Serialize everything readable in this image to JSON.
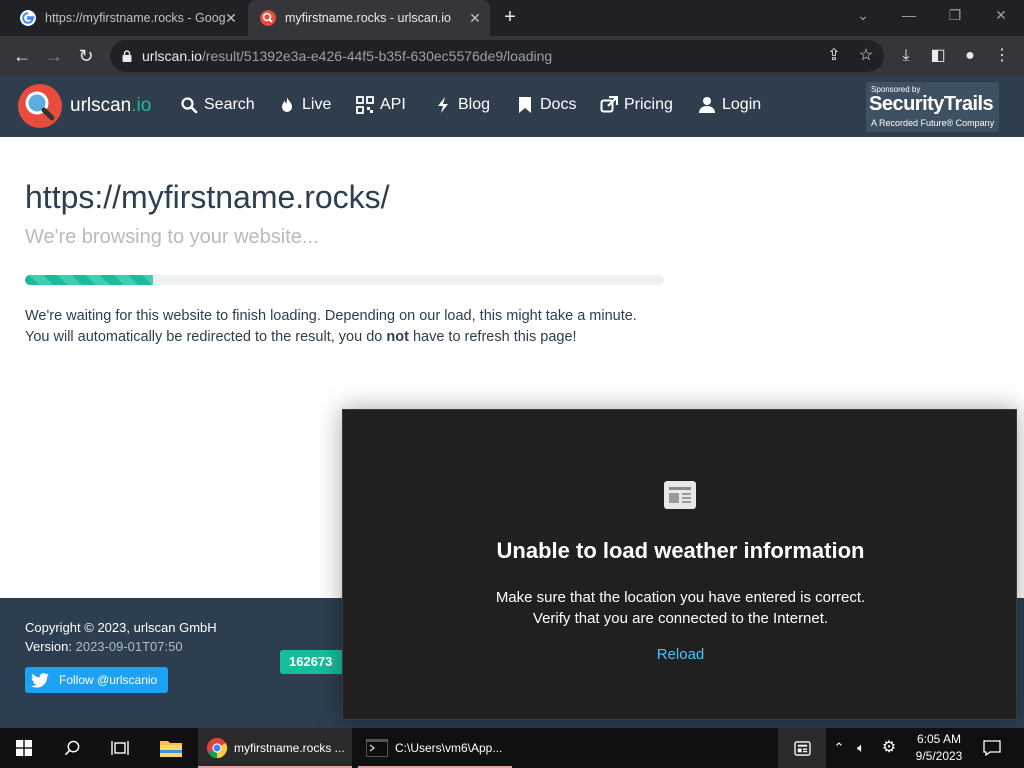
{
  "browser": {
    "tabs": [
      {
        "title": "https://myfirstname.rocks - Goog",
        "active": false,
        "favicon": "google-icon"
      },
      {
        "title": "myfirstname.rocks - urlscan.io",
        "active": true,
        "favicon": "urlscan-icon"
      }
    ],
    "address": {
      "host": "urlscan.io",
      "path": "/result/51392e3a-e426-44f5-b35f-630ec5576de9/loading"
    }
  },
  "site": {
    "logo": {
      "name": "urlscan",
      "tld": ".io"
    },
    "nav": [
      {
        "label": "Search",
        "icon": "search-icon"
      },
      {
        "label": "Live",
        "icon": "fire-icon"
      },
      {
        "label": "API",
        "icon": "qrcode-icon"
      },
      {
        "label": "Blog",
        "icon": "bolt-icon"
      },
      {
        "label": "Docs",
        "icon": "bookmark-icon"
      },
      {
        "label": "Pricing",
        "icon": "external-link-icon"
      },
      {
        "label": "Login",
        "icon": "user-icon"
      }
    ],
    "sponsor": {
      "line1": "Sponsored by",
      "line2": "SecurityTrails",
      "line3": "A Recorded Future® Company"
    }
  },
  "main": {
    "heading": "https://myfirstname.rocks/",
    "subheading": "We're browsing to your website...",
    "progress": 0.2,
    "para_line1": "We're waiting for this website to finish loading. Depending on our load, this might take a minute.",
    "para_line2_a": "You will automatically be redirected to the result, you do ",
    "para_line2_b": "not",
    "para_line2_c": " have to refresh this page!"
  },
  "footer": {
    "copyright": "Copyright © 2023, urlscan GmbH",
    "version_label": "Version:",
    "version": "2023-09-01T07:50",
    "follow": "Follow @urlscanio",
    "counter": "162673"
  },
  "weather": {
    "title": "Unable to load weather information",
    "msg1": "Make sure that the location you have entered is correct.",
    "msg2": "Verify that you are connected to the Internet.",
    "reload": "Reload"
  },
  "taskbar": {
    "chrome_label": "myfirstname.rocks ...",
    "terminal_label": "C:\\Users\\vm6\\App...",
    "time": "6:05 AM",
    "date": "9/5/2023"
  },
  "colors": {
    "header": "#2f3e4c",
    "accent": "#18bc9c",
    "footer": "#2c3e50",
    "logo": "#e74c3c"
  }
}
